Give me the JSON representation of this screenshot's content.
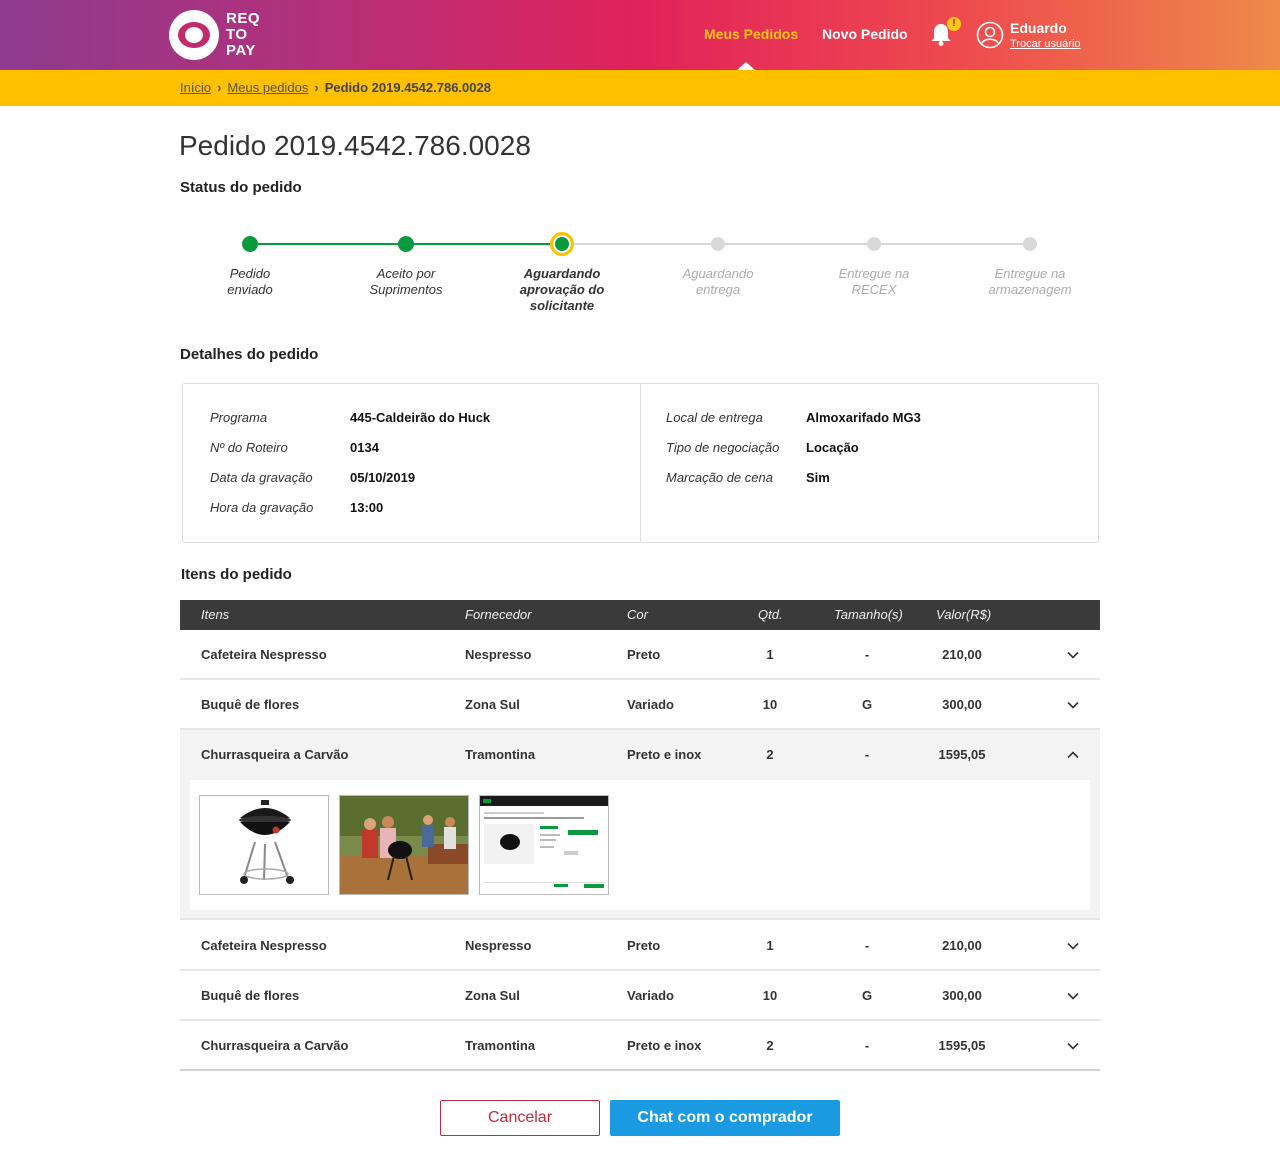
{
  "header": {
    "logo_text": [
      "REQ",
      "TO",
      "PAY"
    ],
    "nav": {
      "my_orders": "Meus Pedidos",
      "new_order": "Novo Pedido"
    },
    "notification_badge": "!",
    "user": {
      "name": "Eduardo",
      "switch_label": "Trocar usuário"
    },
    "colors": {
      "active_nav": "#ffc61a",
      "gradient_start": "#8e3a8e",
      "gradient_end": "#ee8a4a"
    }
  },
  "breadcrumb": {
    "home": "Início",
    "orders": "Meus pedidos",
    "current": "Pedido 2019.4542.786.0028"
  },
  "page": {
    "title": "Pedido 2019.4542.786.0028",
    "status_title": "Status do pedido",
    "details_title": "Detalhes do pedido",
    "items_title": "Itens do pedido"
  },
  "status_steps": [
    {
      "label_lines": [
        "Pedido",
        "enviado"
      ],
      "state": "done"
    },
    {
      "label_lines": [
        "Aceito por",
        "Suprimentos"
      ],
      "state": "done"
    },
    {
      "label_lines": [
        "Aguardando",
        "aprovação do",
        "solicitante"
      ],
      "state": "current"
    },
    {
      "label_lines": [
        "Aguardando",
        "entrega"
      ],
      "state": "todo"
    },
    {
      "label_lines": [
        "Entregue na",
        "RECEX"
      ],
      "state": "todo"
    },
    {
      "label_lines": [
        "Entregue na",
        "armazenagem"
      ],
      "state": "todo"
    }
  ],
  "details": {
    "left": [
      {
        "label": "Programa",
        "value": "445-Caldeirão do Huck"
      },
      {
        "label": "Nº do Roteiro",
        "value": "0134"
      },
      {
        "label": "Data da gravação",
        "value": "05/10/2019"
      },
      {
        "label": "Hora da gravação",
        "value": "13:00"
      }
    ],
    "right": [
      {
        "label": "Local de entrega",
        "value": "Almoxarifado MG3"
      },
      {
        "label": "Tipo de negociação",
        "value": "Locação"
      },
      {
        "label": "Marcação de cena",
        "value": "Sim"
      }
    ]
  },
  "items_table": {
    "headers": [
      "Itens",
      "Fornecedor",
      "Cor",
      "Qtd.",
      "Tamanho(s)",
      "Valor(R$)"
    ],
    "rows": [
      {
        "item": "Cafeteira Nespresso",
        "supplier": "Nespresso",
        "color": "Preto",
        "qty": "1",
        "size": "-",
        "value": "210,00",
        "expanded": false
      },
      {
        "item": "Buquê de flores",
        "supplier": "Zona Sul",
        "color": "Variado",
        "qty": "10",
        "size": "G",
        "value": "300,00",
        "expanded": false
      },
      {
        "item": "Churrasqueira a Carvão",
        "supplier": "Tramontina",
        "color": "Preto e inox",
        "qty": "2",
        "size": "-",
        "value": "1595,05",
        "expanded": true
      },
      {
        "item": "Cafeteira Nespresso",
        "supplier": "Nespresso",
        "color": "Preto",
        "qty": "1",
        "size": "-",
        "value": "210,00",
        "expanded": false
      },
      {
        "item": "Buquê de flores",
        "supplier": "Zona Sul",
        "color": "Variado",
        "qty": "10",
        "size": "G",
        "value": "300,00",
        "expanded": false
      },
      {
        "item": "Churrasqueira a Carvão",
        "supplier": "Tramontina",
        "color": "Preto e inox",
        "qty": "2",
        "size": "-",
        "value": "1595,05",
        "expanded": false
      }
    ],
    "thumbnails": [
      "grill-product-photo",
      "grill-lifestyle-photo",
      "product-page-screenshot"
    ]
  },
  "actions": {
    "cancel": "Cancelar",
    "chat": "Chat com o comprador"
  }
}
